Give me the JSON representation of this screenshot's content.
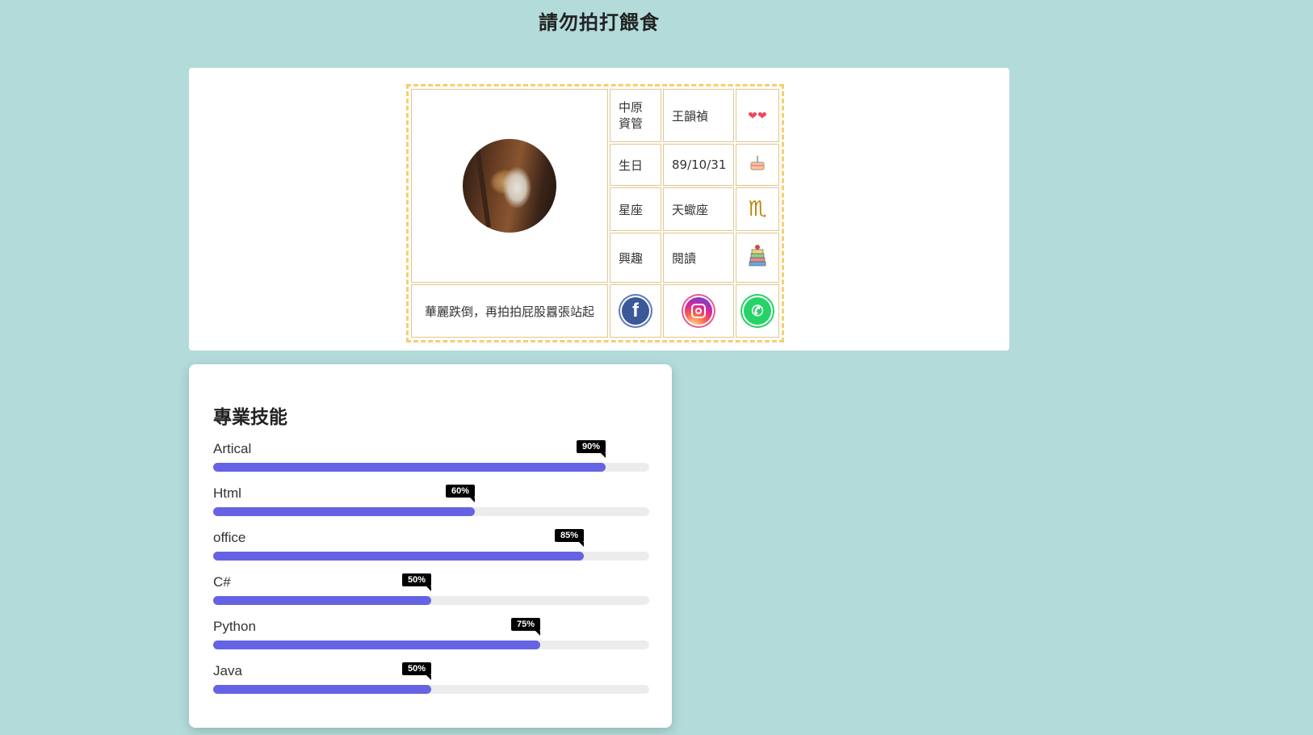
{
  "page": {
    "title": "請勿拍打餵食"
  },
  "profile": {
    "school": "中原\n資管",
    "name": "王韻禎",
    "name_icon": "hearts-icon",
    "birthday_label": "生日",
    "birthday_value": "89/10/31",
    "birthday_icon": "cake-icon",
    "zodiac_label": "星座",
    "zodiac_value": "天蠍座",
    "zodiac_icon": "scorpio-icon",
    "hobby_label": "興趣",
    "hobby_value": "閱讀",
    "hobby_icon": "books-icon",
    "motto": "華麗跌倒，再拍拍屁股囂張站起",
    "social": [
      {
        "name": "facebook",
        "icon": "facebook-icon",
        "color": "#3b5998"
      },
      {
        "name": "instagram",
        "icon": "instagram-icon",
        "color": "#d6249f"
      },
      {
        "name": "whatsapp",
        "icon": "whatsapp-icon",
        "color": "#25d366"
      }
    ]
  },
  "skills": {
    "title": "專業技能",
    "bar_color": "#6563e3",
    "items": [
      {
        "label": "Artical",
        "percent": 90,
        "percent_label": "90%"
      },
      {
        "label": "Html",
        "percent": 60,
        "percent_label": "60%"
      },
      {
        "label": "office",
        "percent": 85,
        "percent_label": "85%"
      },
      {
        "label": "C#",
        "percent": 50,
        "percent_label": "50%"
      },
      {
        "label": "Python",
        "percent": 75,
        "percent_label": "75%"
      },
      {
        "label": "Java",
        "percent": 50,
        "percent_label": "50%"
      }
    ]
  }
}
